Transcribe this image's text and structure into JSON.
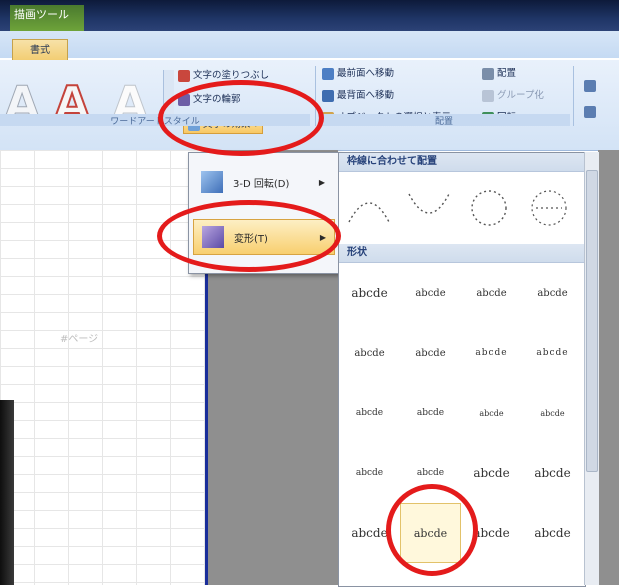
{
  "ribbon": {
    "context_label": "描画ツール",
    "active_tab": "書式",
    "wordart_styles_caption": "ワードアートスタイル",
    "arrange_caption": "配置",
    "wordart_commands": {
      "fill": "文字の塗りつぶし",
      "outline": "文字の輪郭",
      "effects": "文字の効果"
    },
    "arrange_commands": {
      "bring_front": "最前面へ移動",
      "send_back": "最背面へ移動",
      "selection_pane": "オブジェクトの選択と表示",
      "align": "配置",
      "group": "グループ化",
      "rotate": "回転"
    }
  },
  "submenu": {
    "rotation_3d": "3-D 回転(D)",
    "transform": "変形(T)"
  },
  "gallery": {
    "section_path": "枠線に合わせて配置",
    "section_warp": "形状",
    "warp_rows": [
      [
        "abcde",
        "abcde",
        "abcde",
        "abcde"
      ],
      [
        "abcde",
        "abcde",
        "abcde",
        "abcde"
      ],
      [
        "abcde",
        "abcde",
        "abcde",
        "abcde"
      ],
      [
        "abcde",
        "abcde",
        "abcde",
        "abcde"
      ],
      [
        "abcde",
        "abcde",
        "abcde",
        "abcde"
      ]
    ]
  },
  "sheet": {
    "page_label": "#ページ"
  },
  "colors": {
    "highlight": "#f8c865",
    "annotation_red": "#e41b1b",
    "rule_blue": "#1a2e9a"
  }
}
